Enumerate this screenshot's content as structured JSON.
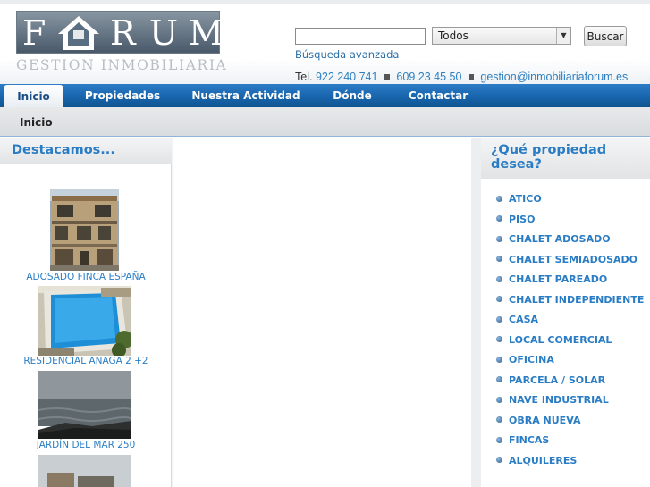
{
  "logo": {
    "letters": [
      "F",
      "O",
      "R",
      "U",
      "M"
    ],
    "subtitle": "GESTION INMOBILIARIA"
  },
  "search": {
    "value": "",
    "placeholder": "",
    "select_value": "Todos",
    "button_label": "Buscar",
    "advanced_link": "Búsqueda avanzada"
  },
  "contact": {
    "prefix": "Tel.",
    "phone1": "922 240 741",
    "phone2": "609 23 45 50",
    "email": "gestion@inmobiliariaforum.es"
  },
  "nav": {
    "tabs": [
      {
        "label": "Inicio"
      },
      {
        "label": "Propiedades"
      },
      {
        "label": "Nuestra Actividad"
      },
      {
        "label": "Dónde"
      },
      {
        "label": "Contactar"
      }
    ]
  },
  "breadcrumb": "Inicio",
  "featured": {
    "title": "Destacamos...",
    "items": [
      {
        "label": "ADOSADO FINCA ESPAÑA"
      },
      {
        "label": "RESIDENCIAL ANAGA 2 +2"
      },
      {
        "label": "JARDÍN DEL MAR 250"
      }
    ]
  },
  "property_types": {
    "title": "¿Qué propiedad desea?",
    "items": [
      "ATICO",
      "PISO",
      "CHALET ADOSADO",
      "CHALET SEMIADOSADO",
      "CHALET PAREADO",
      "CHALET INDEPENDIENTE",
      "CASA",
      "LOCAL COMERCIAL",
      "OFICINA",
      "PARCELA / SOLAR",
      "NAVE INDUSTRIAL",
      "OBRA NUEVA",
      "FINCAS",
      "ALQUILERES"
    ]
  },
  "colors": {
    "accent": "#2a7dc4",
    "nav": "#1865ad"
  }
}
